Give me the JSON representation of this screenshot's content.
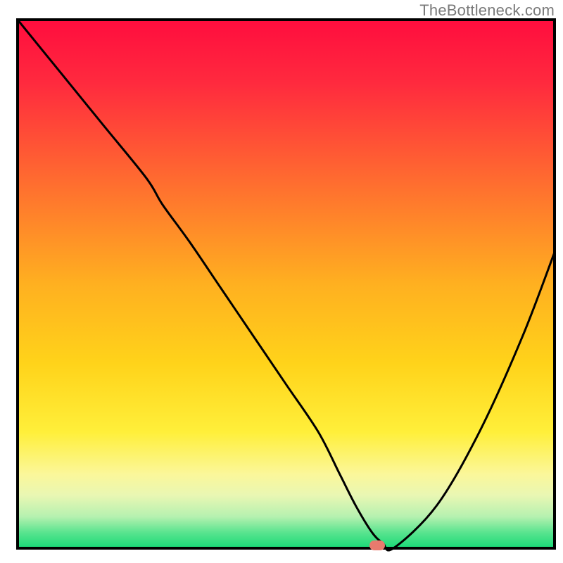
{
  "watermark": "TheBottleneck.com",
  "colors": {
    "frame": "#000000",
    "curve": "#000000",
    "marker": "#e87a6e",
    "gradient_stops": [
      {
        "offset": 0.0,
        "color": "#ff0d3e"
      },
      {
        "offset": 0.12,
        "color": "#ff2a3e"
      },
      {
        "offset": 0.3,
        "color": "#ff6a30"
      },
      {
        "offset": 0.5,
        "color": "#ffb020"
      },
      {
        "offset": 0.65,
        "color": "#ffd31a"
      },
      {
        "offset": 0.78,
        "color": "#ffef3a"
      },
      {
        "offset": 0.86,
        "color": "#fbf79a"
      },
      {
        "offset": 0.9,
        "color": "#e9f7b3"
      },
      {
        "offset": 0.94,
        "color": "#b6f1b0"
      },
      {
        "offset": 0.97,
        "color": "#5ae48f"
      },
      {
        "offset": 1.0,
        "color": "#18d977"
      }
    ]
  },
  "layout": {
    "total_size": 800,
    "plot_left": 25,
    "plot_top": 28,
    "plot_right": 788,
    "plot_bottom": 779
  },
  "chart_data": {
    "type": "line",
    "title": "",
    "xlabel": "",
    "ylabel": "",
    "xlim": [
      0,
      100
    ],
    "ylim": [
      0,
      100
    ],
    "note": "Axes are unlabeled in the figure; values are estimated percentages of the plot area (x = left→right, y = bottom→top).",
    "series": [
      {
        "name": "curve",
        "x": [
          0,
          8,
          16,
          24,
          27,
          32,
          38,
          44,
          50,
          56,
          60,
          63,
          66,
          68,
          70,
          78,
          86,
          94,
          100
        ],
        "y": [
          100,
          90,
          80,
          70,
          65,
          58,
          49,
          40,
          31,
          22,
          14,
          8,
          3,
          1,
          0,
          8,
          22,
          40,
          56
        ]
      }
    ],
    "marker": {
      "x": 67,
      "y": 0.5,
      "color": "#e87a6e"
    },
    "background": "vertical red→yellow→green gradient"
  }
}
